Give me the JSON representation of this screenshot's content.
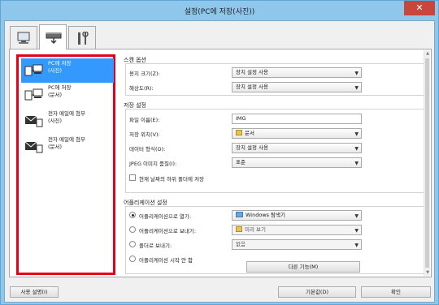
{
  "window": {
    "title": "설정(PC에 저장(사진))",
    "close_glyph": "✕"
  },
  "tabs": [
    {
      "name": "computer-tab",
      "icon": "computer-icon"
    },
    {
      "name": "scanner-tab",
      "icon": "scanner-icon"
    },
    {
      "name": "tools-tab",
      "icon": "tools-icon"
    }
  ],
  "sidebar": {
    "items": [
      {
        "label": "PC에 저장\n(사진)",
        "icon": "save-to-pc-icon",
        "selected": true
      },
      {
        "label": "PC에 저장\n(문서)",
        "icon": "save-to-pc-icon",
        "selected": false
      },
      {
        "label": "전자 메일에 첨부\n(사진)",
        "icon": "email-icon",
        "selected": false
      },
      {
        "label": "전자 메일에 첨부\n(문서)",
        "icon": "email-icon",
        "selected": false
      }
    ]
  },
  "scan_options": {
    "title": "스캔 옵션",
    "paper_size_label": "용지 크기(Z):",
    "paper_size_value": "장치 설정 사용",
    "resolution_label": "해상도(R):",
    "resolution_value": "장치 설정 사용"
  },
  "save_settings": {
    "title": "저장 설정",
    "file_name_label": "파일 이름(E):",
    "file_name_value": "IMG",
    "save_in_label": "저장 위치(V):",
    "save_in_value": "문서",
    "data_format_label": "데이터 형식(O):",
    "data_format_value": "장치 설정 사용",
    "jpeg_quality_label": "JPEG 이미지 품질(I):",
    "jpeg_quality_value": "표준",
    "subfolder_label": "현재 날짜의 하위 폴더에 저장"
  },
  "app_settings": {
    "title": "어플리케이션 설정",
    "open_app_label": "어플리케이션으로 열기:",
    "open_app_value": "Windows 탐색기",
    "send_app_label": "어플리케이션으로 보내기:",
    "send_app_value": "미리 보기",
    "send_folder_label": "폴더로 보내기:",
    "send_folder_value": "없음",
    "no_app_label": "어플리케이션 시작 안 함",
    "more_functions_label": "다른 기능(M)"
  },
  "footer": {
    "instructions_label": "사용 설명(I)",
    "defaults_label": "기본값(D)",
    "ok_label": "확인"
  }
}
